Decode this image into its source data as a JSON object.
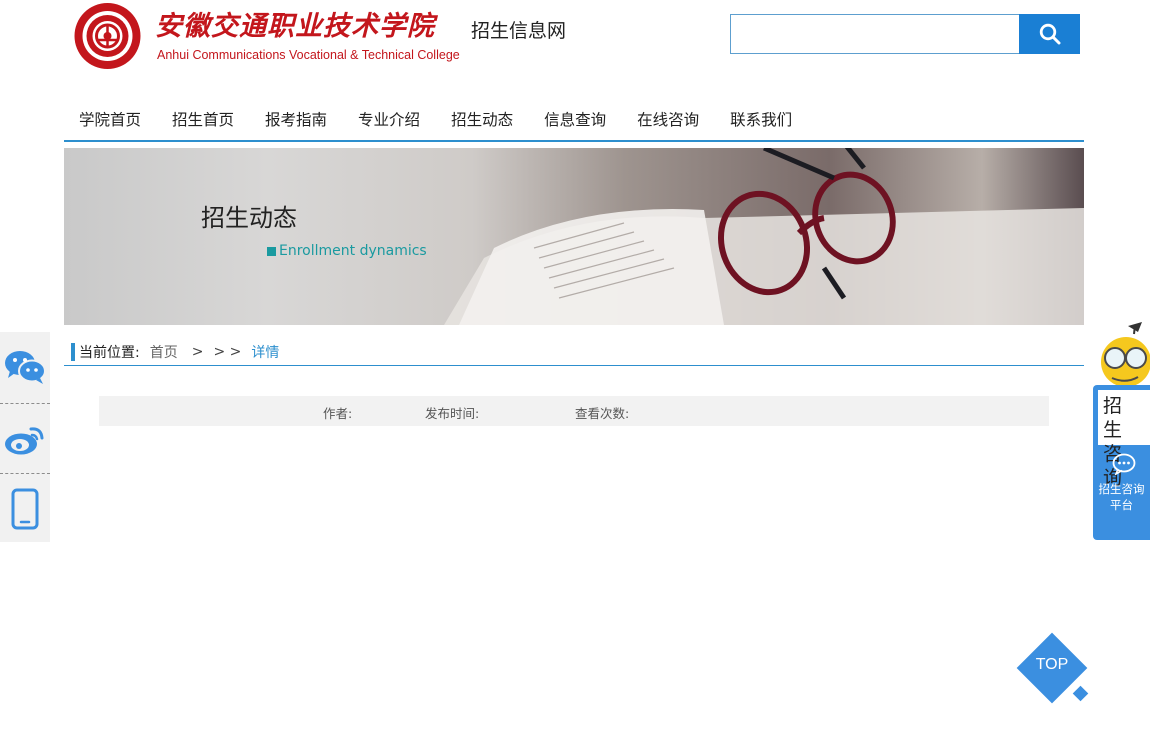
{
  "header": {
    "college_name_cn": "安徽交通职业技术学院",
    "site_name": "招生信息网",
    "college_name_en": "Anhui  Communications Vocational & Technical College",
    "search": {
      "placeholder": "",
      "button_icon": "search-icon"
    }
  },
  "nav": {
    "items": [
      {
        "label": "学院首页"
      },
      {
        "label": "招生首页"
      },
      {
        "label": "报考指南"
      },
      {
        "label": "专业介绍"
      },
      {
        "label": "招生动态"
      },
      {
        "label": "信息查询"
      },
      {
        "label": "在线咨询"
      },
      {
        "label": "联系我们"
      }
    ]
  },
  "banner": {
    "title": "招生动态",
    "subtitle": "Enrollment dynamics"
  },
  "breadcrumb": {
    "label": "当前位置:",
    "home": "首页",
    "sep1": ">",
    "sep2": "> >",
    "current": "详情"
  },
  "article_meta": {
    "author_label": "作者:",
    "publish_label": "发布时间:",
    "views_label": "查看次数:"
  },
  "side_social": {
    "icons": [
      "wechat-icon",
      "weibo-icon",
      "mobile-icon"
    ]
  },
  "consult_widget": {
    "label_line1": "招 生",
    "label_line2": "咨 询",
    "platform_line1": "招生咨询",
    "platform_line2": "平台"
  },
  "back_to_top": {
    "label": "TOP"
  },
  "colors": {
    "accent_blue": "#2d8fce",
    "button_blue": "#1a7fd4",
    "brand_red": "#c3161c",
    "teal": "#1a9aa0"
  }
}
